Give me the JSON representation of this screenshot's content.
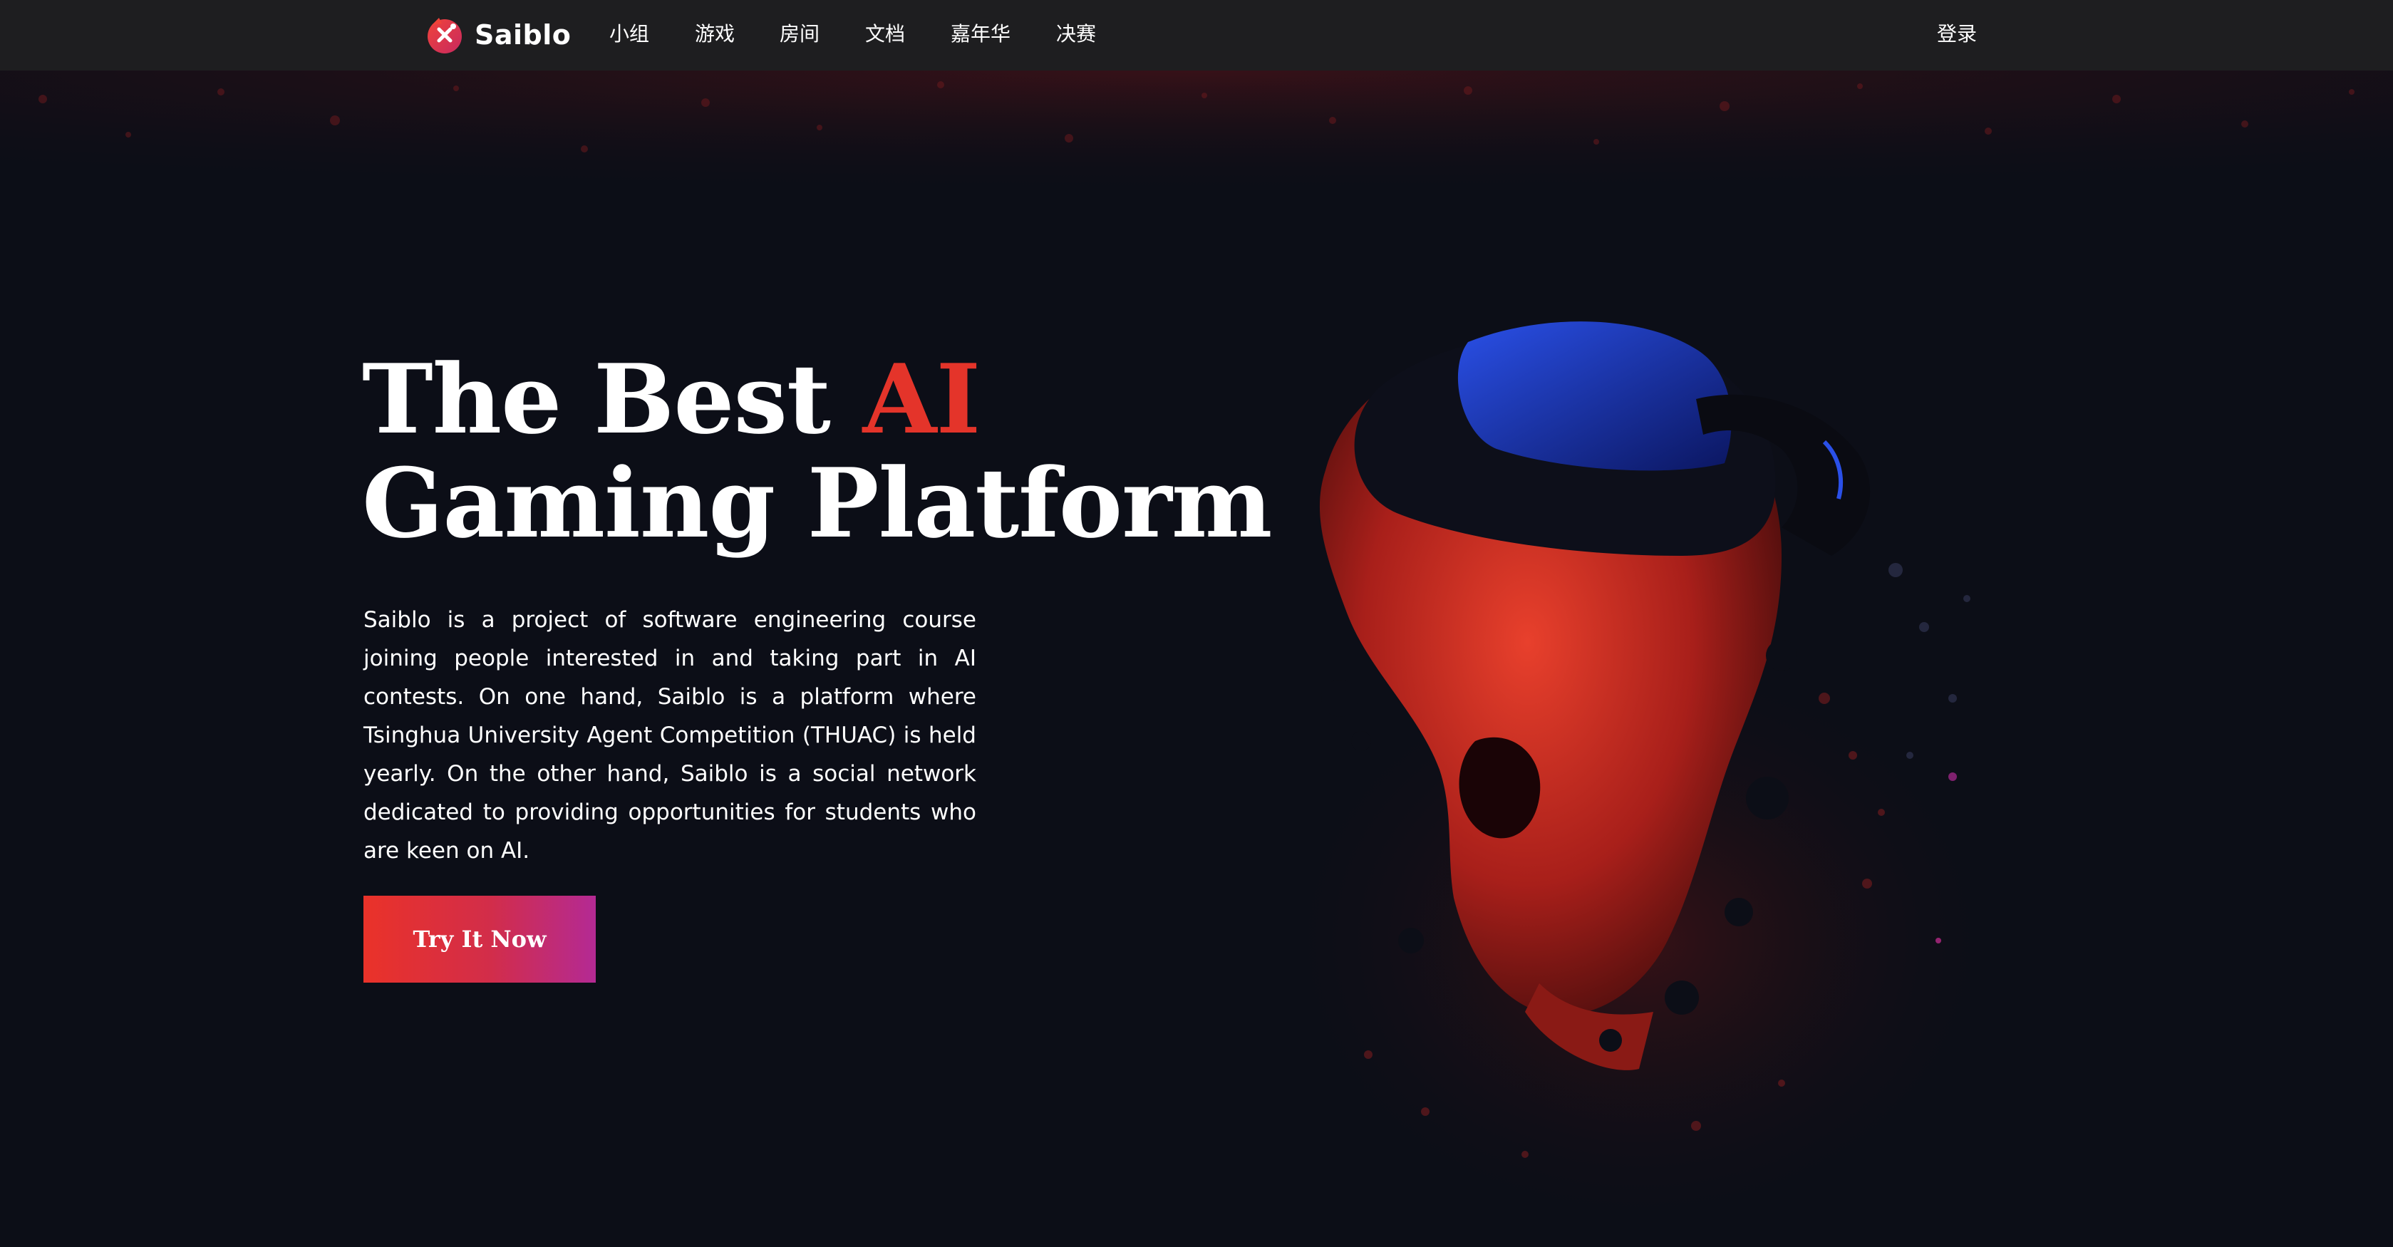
{
  "brand": {
    "name": "Saiblo",
    "logo_icon": "saiblo-logo-icon"
  },
  "nav": {
    "items": [
      {
        "label": "小组"
      },
      {
        "label": "游戏"
      },
      {
        "label": "房间"
      },
      {
        "label": "文档"
      },
      {
        "label": "嘉年华"
      },
      {
        "label": "决赛"
      }
    ],
    "login_label": "登录"
  },
  "hero": {
    "title_part1": "The Best ",
    "title_accent": "AI",
    "title_line2": "Gaming Platform",
    "description": "Saiblo is a project of software engineering course joining people interested in and taking part in AI contests. On one hand, Saiblo is a platform where Tsinghua University Agent Competition (THUAC) is held yearly. On the other hand, Saiblo is a social network dedicated to providing opportunities for students who are keen on AI.",
    "cta_label": "Try It Now",
    "illustration_icon": "vr-headset-person-icon"
  },
  "colors": {
    "navbar_bg": "#1e1e20",
    "page_bg": "#0c0e17",
    "accent": "#e4342a",
    "cta_gradient_start": "#ea3229",
    "cta_gradient_end": "#b42a94",
    "headset_blue": "#1d3fcf"
  }
}
